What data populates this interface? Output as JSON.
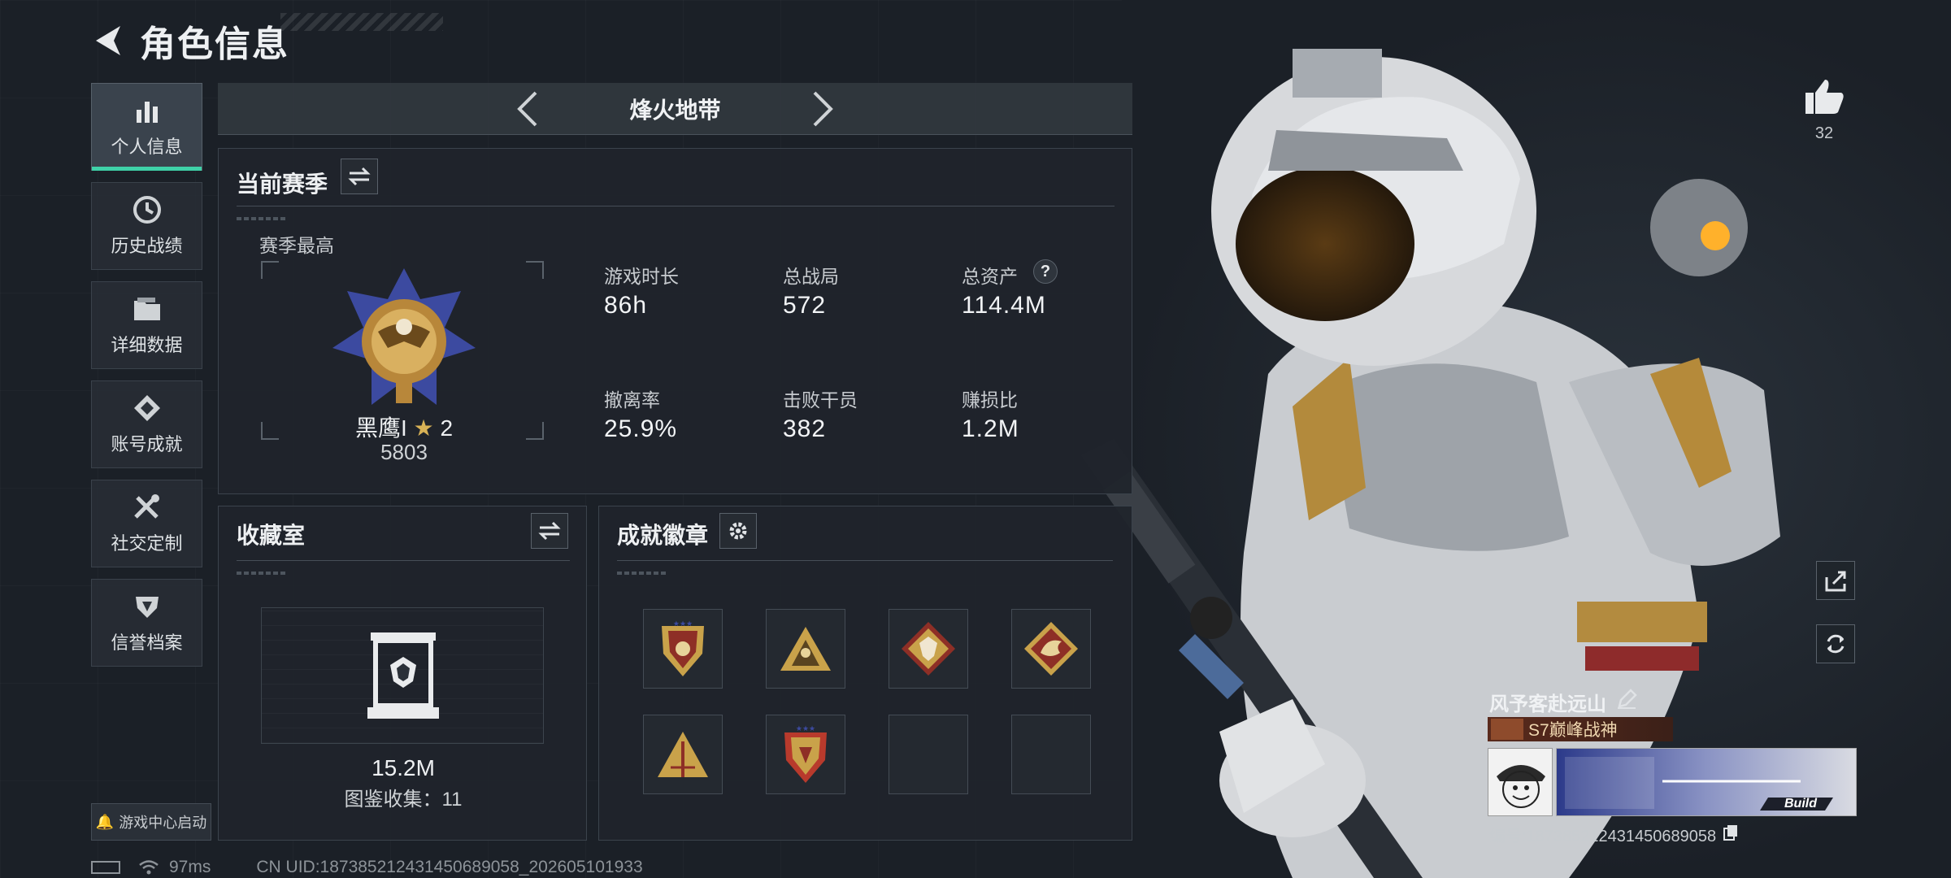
{
  "header": {
    "title": "角色信息"
  },
  "sidebar": {
    "items": [
      {
        "label": "个人信息",
        "icon": "bar-chart-icon",
        "active": true
      },
      {
        "label": "历史战绩",
        "icon": "clock-icon"
      },
      {
        "label": "详细数据",
        "icon": "folder-icon"
      },
      {
        "label": "账号成就",
        "icon": "achievement-icon"
      },
      {
        "label": "社交定制",
        "icon": "tools-icon"
      },
      {
        "label": "信誉档案",
        "icon": "shield-icon"
      }
    ],
    "launch_label": "游戏中心启动"
  },
  "season_nav": {
    "title": "烽火地带"
  },
  "current_season": {
    "title": "当前赛季",
    "best_label": "赛季最高",
    "rank_name": "黑鹰I",
    "rank_stars": "2",
    "rank_score": "5803",
    "stats": [
      {
        "label": "游戏时长",
        "value": "86h"
      },
      {
        "label": "总战局",
        "value": "572"
      },
      {
        "label": "总资产",
        "value": "114.4M",
        "help": "?"
      },
      {
        "label": "撤离率",
        "value": "25.9%"
      },
      {
        "label": "击败干员",
        "value": "382"
      },
      {
        "label": "赚损比",
        "value": "1.2M"
      }
    ]
  },
  "collection": {
    "title": "收藏室",
    "value": "15.2M",
    "count_text": "图鉴收集：11"
  },
  "badges": {
    "title": "成就徽章",
    "slots": [
      {
        "icon": "shield-badge-icon",
        "filled": true
      },
      {
        "icon": "triangle-badge-icon",
        "filled": true
      },
      {
        "icon": "wolf-badge-icon",
        "filled": true
      },
      {
        "icon": "dragon-badge-icon",
        "filled": true
      },
      {
        "icon": "pyramid-badge-icon",
        "filled": true
      },
      {
        "icon": "crest-badge-icon",
        "filled": true
      },
      {
        "icon": "empty-slot",
        "filled": false
      },
      {
        "icon": "empty-slot",
        "filled": false
      }
    ]
  },
  "profile": {
    "name": "风予客赴远山",
    "title_tag": "S7巅峰战神",
    "id_text": "编号:18738521243145068905​8"
  },
  "like": {
    "count": "32"
  },
  "status": {
    "ping": "97ms",
    "uid": "CN UID:18738521243145068905​8_202605101933"
  },
  "colors": {
    "accent": "#3fd2a8",
    "gold": "#c9a24a",
    "panel": "#1f242b"
  }
}
